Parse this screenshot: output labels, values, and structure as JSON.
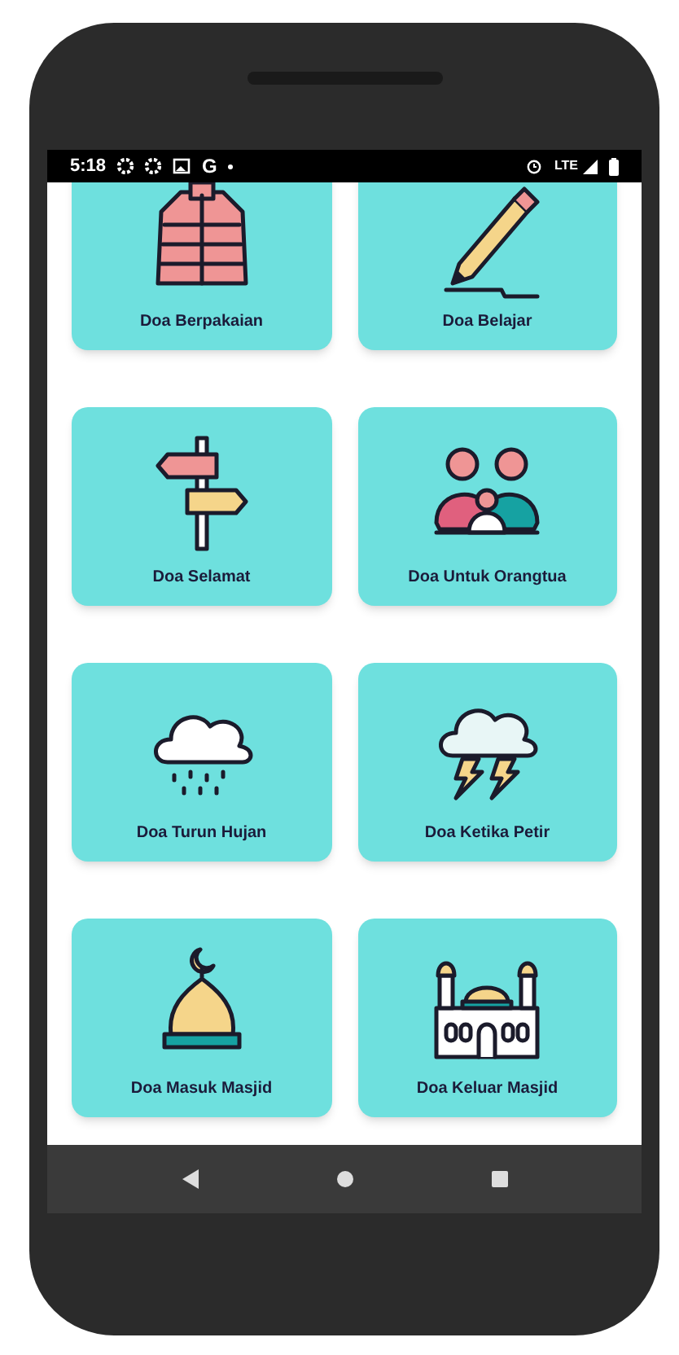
{
  "status_bar": {
    "time": "5:18",
    "carrier_mark": "G",
    "network": "LTE"
  },
  "cards": [
    {
      "label": "Doa Berpakaian",
      "kind": "jacket"
    },
    {
      "label": "Doa Belajar",
      "kind": "pencil"
    },
    {
      "label": "Doa Selamat",
      "kind": "signpost"
    },
    {
      "label": "Doa Untuk Orangtua",
      "kind": "family"
    },
    {
      "label": "Doa Turun Hujan",
      "kind": "rain"
    },
    {
      "label": "Doa Ketika Petir",
      "kind": "storm"
    },
    {
      "label": "Doa Masuk Masjid",
      "kind": "dome"
    },
    {
      "label": "Doa Keluar Masjid",
      "kind": "mosque"
    }
  ]
}
